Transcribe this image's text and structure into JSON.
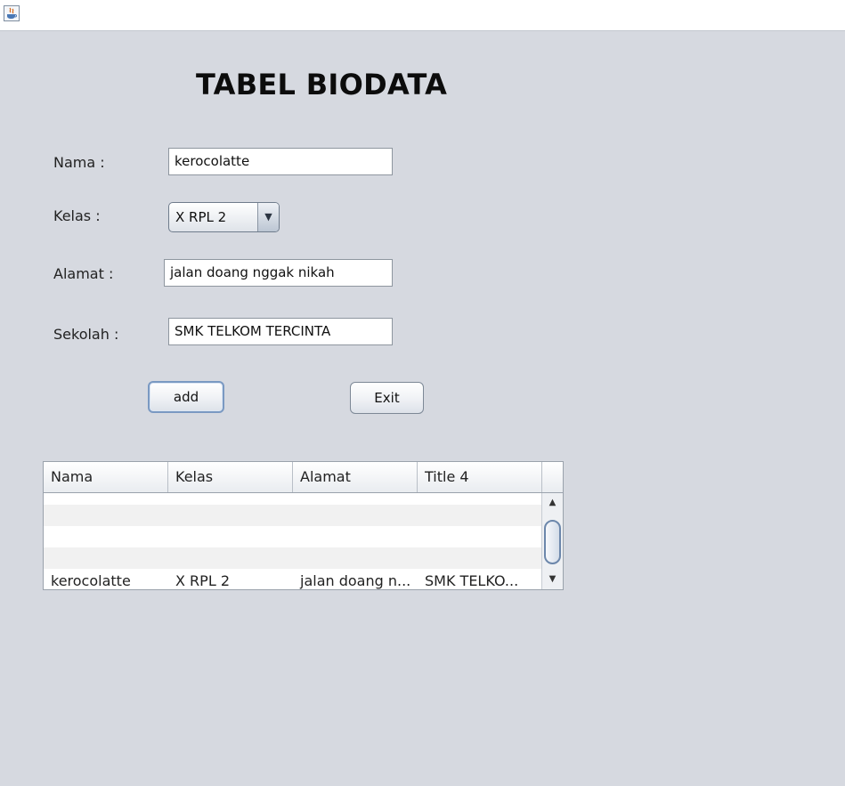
{
  "window": {
    "icon": "java-app-icon"
  },
  "title": "TABEL BIODATA",
  "form": {
    "nama_label": "Nama   :",
    "nama_value": "kerocolatte",
    "kelas_label": "Kelas    :",
    "kelas_value": "X RPL 2",
    "alamat_label": "Alamat :",
    "alamat_value": "jalan doang nggak nikah",
    "sekolah_label": "Sekolah :",
    "sekolah_value": "SMK TELKOM TERCINTA"
  },
  "buttons": {
    "add": "add",
    "exit": "Exit"
  },
  "table": {
    "columns": [
      "Nama",
      "Kelas",
      "Alamat",
      "Title 4"
    ],
    "rows": [
      [
        "",
        "",
        "",
        ""
      ],
      [
        "",
        "",
        "",
        ""
      ],
      [
        "",
        "",
        "",
        ""
      ],
      [
        "",
        "",
        "",
        ""
      ],
      [
        "kerocolatte",
        "X RPL 2",
        "jalan doang n...",
        "SMK TELKO..."
      ]
    ]
  },
  "colors": {
    "background": "#d6d9e0",
    "focus_border": "#7a99c2"
  }
}
